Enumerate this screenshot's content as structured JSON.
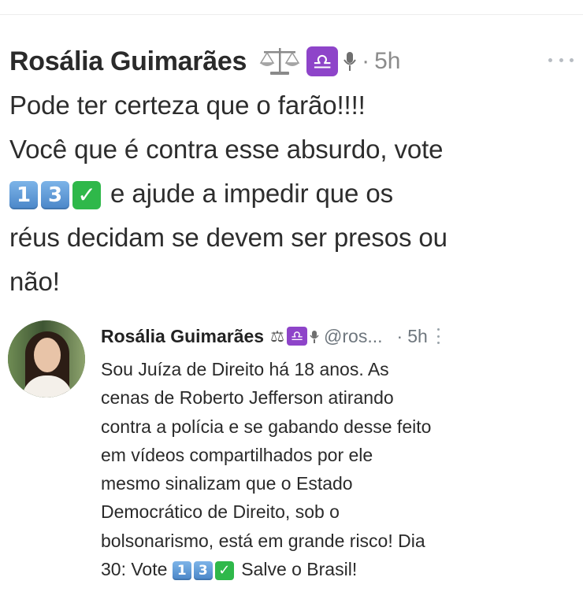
{
  "main_post": {
    "author": "Rosália Guimarães",
    "libra_symbol": "♎",
    "separator": "·",
    "time": "5h",
    "text_lines": [
      "Pode ter certeza que o farão!!!!",
      "Você que é contra esse absurdo, vote",
      "e ajude a impedir que os",
      "réus decidam se devem ser presos ou",
      "não!"
    ],
    "vote_digits": [
      "1",
      "3"
    ],
    "check_symbol": "✓"
  },
  "quoted_post": {
    "author": "Rosália Guimarães",
    "scale_symbol": "⚖",
    "libra_symbol": "♎",
    "handle": "@ros...",
    "separator": "·",
    "time": "5h",
    "text_lines": [
      "Sou Juíza de Direito há 18 anos. As",
      "cenas de Roberto Jefferson atirando",
      "contra a polícia e se gabando desse feito",
      "em vídeos compartilhados por ele",
      "mesmo sinalizam que o Estado",
      "Democrático de Direito, sob o",
      "bolsonarismo, está em grande risco! Dia",
      "30: Vote",
      "Salve o Brasil!"
    ],
    "vote_digits": [
      "1",
      "3"
    ],
    "check_symbol": "✓"
  },
  "icons": {
    "scale": "balance-scale-icon",
    "libra": "libra-zodiac-icon",
    "microphone": "microphone-icon",
    "more": "more-options-icon",
    "avatar": "profile-photo"
  },
  "colors": {
    "keycap_blue": "#4a86c8",
    "check_green": "#2fb84a",
    "libra_purple": "#8e44c9",
    "muted_gray": "#8b8b8b"
  }
}
